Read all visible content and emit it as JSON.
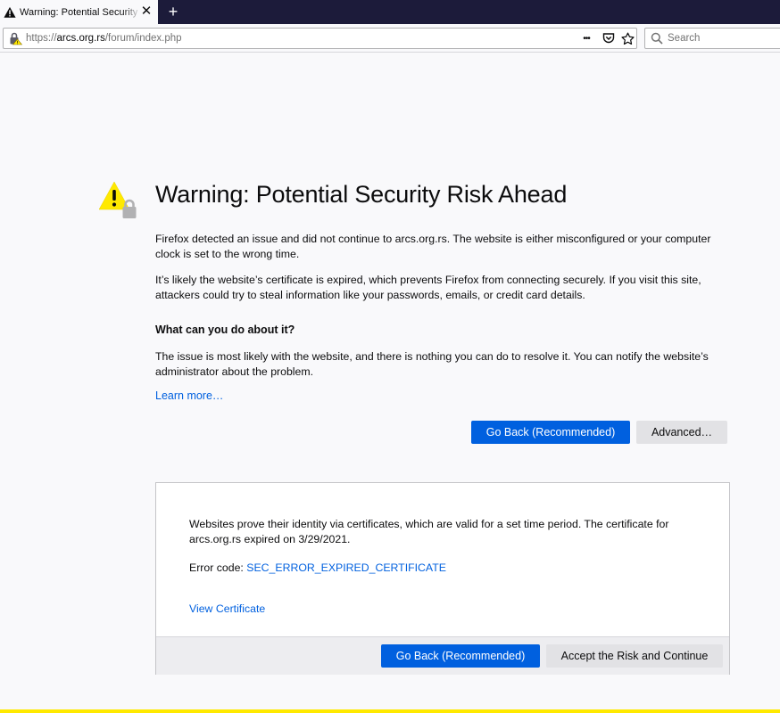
{
  "tab": {
    "title": "Warning: Potential Security Risk Ahead",
    "close_glyph": "✕",
    "new_tab_glyph": "+"
  },
  "urlbar": {
    "scheme": "https://",
    "host": "arcs.org.rs",
    "path": "/forum/index.php",
    "menu_glyph": "•••"
  },
  "search": {
    "placeholder": "Search"
  },
  "content": {
    "title": "Warning: Potential Security Risk Ahead",
    "para1": "Firefox detected an issue and did not continue to arcs.org.rs. The website is either misconfigured or your computer clock is set to the wrong time.",
    "para2": "It’s likely the website’s certificate is expired, which prevents Firefox from connecting securely. If you visit this site, attackers could try to steal information like your passwords, emails, or credit card details.",
    "heading": "What can you do about it?",
    "para3": "The issue is most likely with the website, and there is nothing you can do to resolve it. You can notify the website’s administrator about the problem.",
    "learn_more": "Learn more…",
    "go_back_label": "Go Back (Recommended)",
    "advanced_label": "Advanced…"
  },
  "advanced": {
    "explanation": "Websites prove their identity via certificates, which are valid for a set time period. The certificate for arcs.org.rs expired on 3/29/2021.",
    "error_label": "Error code: ",
    "error_code": "SEC_ERROR_EXPIRED_CERTIFICATE",
    "view_certificate": "View Certificate",
    "go_back_label": "Go Back (Recommended)",
    "accept_label": "Accept the Risk and Continue"
  },
  "colors": {
    "accent": "#0060df",
    "warning_yellow": "#ffe900",
    "tabstrip": "#1c1b3a"
  }
}
